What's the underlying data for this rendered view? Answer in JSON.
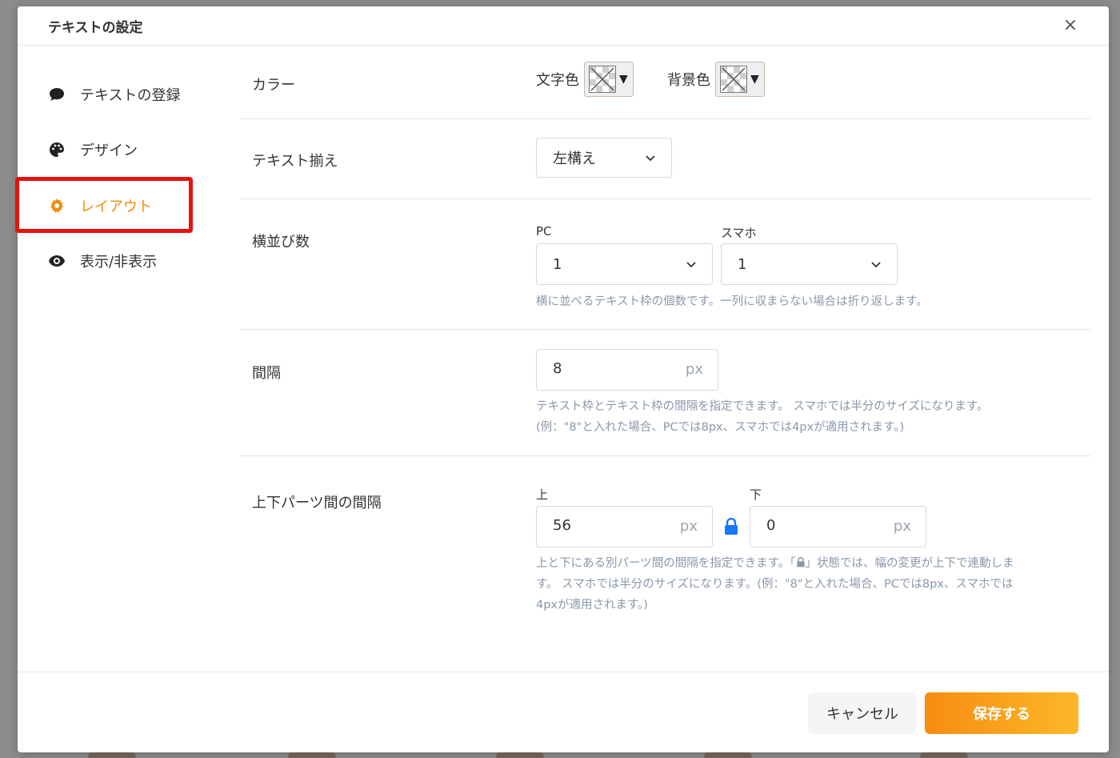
{
  "dialog": {
    "title": "テキストの設定",
    "close_label": "×"
  },
  "sidebar": {
    "items": [
      {
        "label": "テキストの登録",
        "icon": "comment-icon"
      },
      {
        "label": "デザイン",
        "icon": "palette-icon"
      },
      {
        "label": "レイアウト",
        "icon": "gear-icon",
        "active": true
      },
      {
        "label": "表示/非表示",
        "icon": "eye-icon"
      }
    ]
  },
  "color": {
    "label": "カラー",
    "text_color_label": "文字色",
    "bg_color_label": "背景色"
  },
  "align": {
    "label": "テキスト揃え",
    "value": "左構え"
  },
  "columns": {
    "label": "横並び数",
    "pc_label": "PC",
    "pc_value": "1",
    "sp_label": "スマホ",
    "sp_value": "1",
    "hint": "横に並べるテキスト枠の個数です。一列に収まらない場合は折り返します。"
  },
  "gap": {
    "label": "間隔",
    "value": "8",
    "unit": "px",
    "hint1": "テキスト枠とテキスト枠の間隔を指定できます。 スマホでは半分のサイズになります。",
    "hint2": "(例：\"8\"と入れた場合、PCでは8px、スマホでは4pxが適用されます。)"
  },
  "parts_gap": {
    "label": "上下パーツ間の間隔",
    "top_label": "上",
    "top_value": "56",
    "bottom_label": "下",
    "bottom_value": "0",
    "unit": "px",
    "hint1_a": "上と下にある別パーツ間の間隔を指定できます。「",
    "hint1_b": "」状態では、幅の変更が上下で連動しま",
    "hint2": "す。 スマホでは半分のサイズになります。(例：\"8\"と入れた場合、PCでは8px、スマホでは",
    "hint3": "4pxが適用されます。)"
  },
  "footer": {
    "cancel_label": "キャンセル",
    "save_label": "保存する"
  },
  "colors": {
    "accent": "#f08c0a",
    "highlight": "#e8120c",
    "hint": "#8a98aa",
    "lock": "#1677ff"
  }
}
